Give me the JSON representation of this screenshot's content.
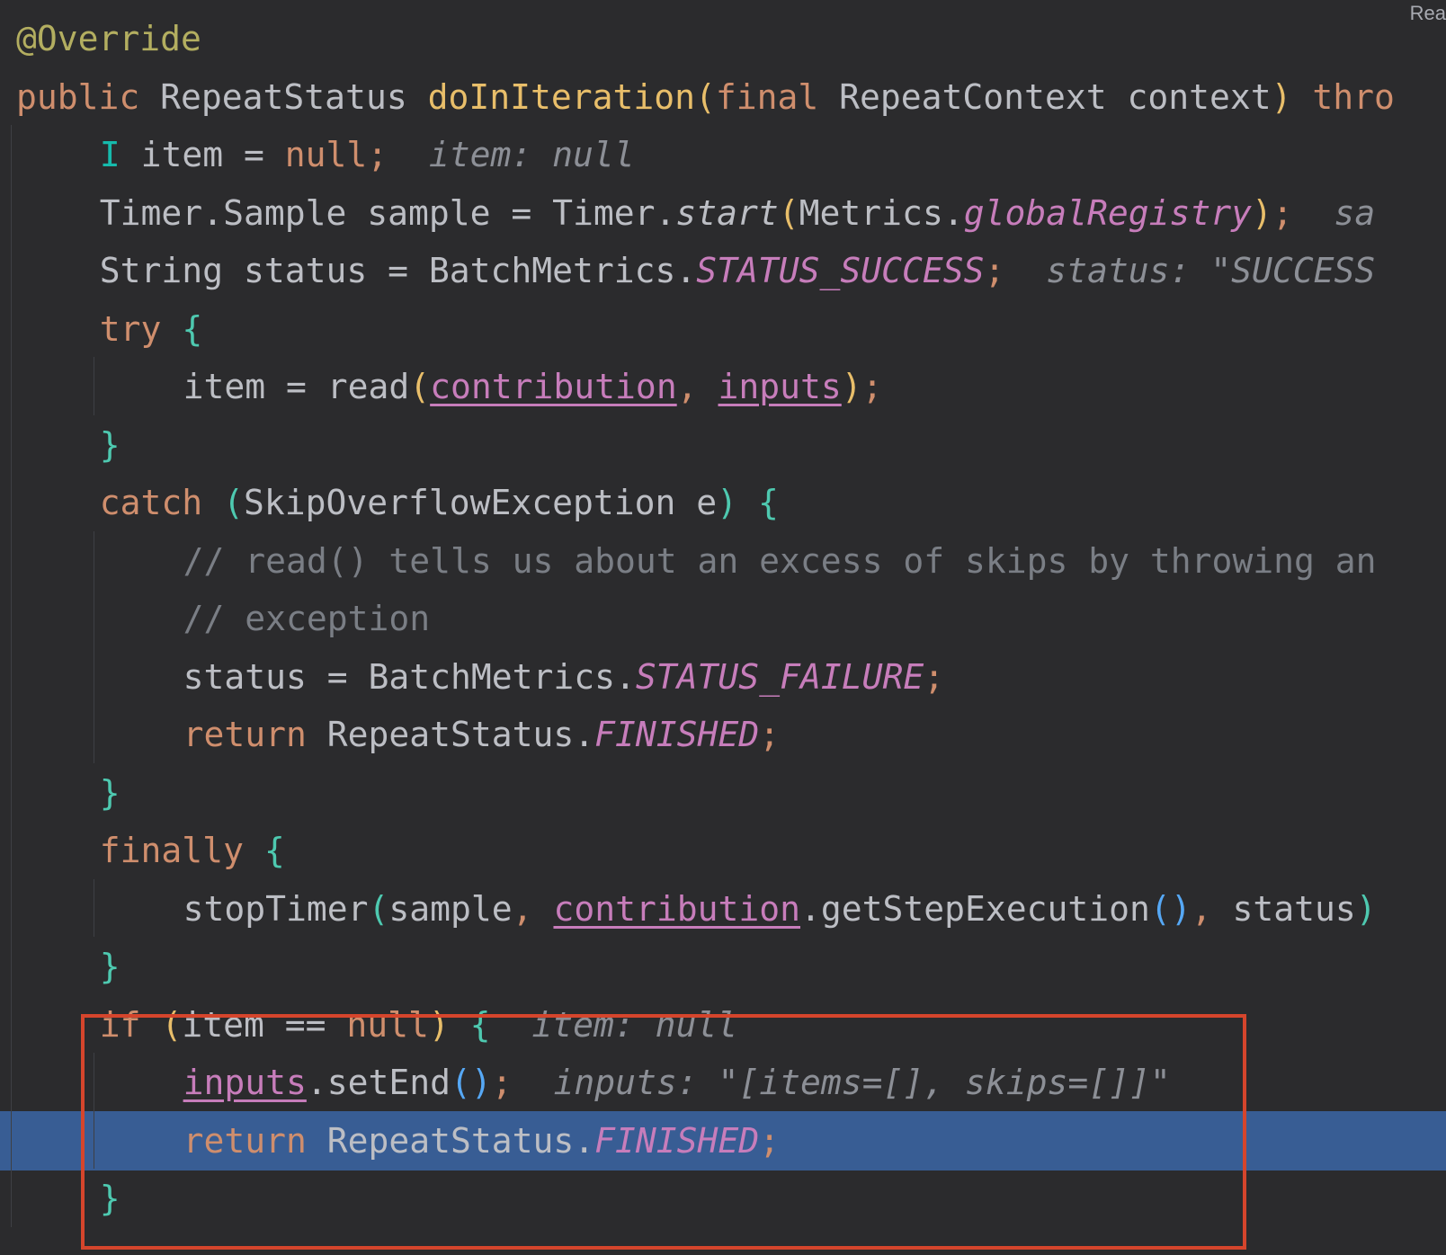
{
  "corner_label": "Rea",
  "colors": {
    "background": "#2b2b2d",
    "execution_line": "#385d94",
    "highlight_box": "#d5452c",
    "keyword": "#cf8e6d",
    "annotation": "#b3ae60",
    "field": "#c77dbb",
    "comment": "#7a7e85",
    "inline_hint": "#8c8f96"
  },
  "code_lines": [
    {
      "indent": 0,
      "tokens": [
        {
          "t": "@Override",
          "c": "ann"
        }
      ]
    },
    {
      "indent": 0,
      "tokens": [
        {
          "t": "public",
          "c": "kw"
        },
        {
          "t": " RepeatStatus "
        },
        {
          "t": "doInIteration",
          "c": "fn-def"
        },
        {
          "t": "(",
          "c": "br1"
        },
        {
          "t": "final",
          "c": "kw"
        },
        {
          "t": " RepeatContext context"
        },
        {
          "t": ")",
          "c": "br1"
        },
        {
          "t": " "
        },
        {
          "t": "thro",
          "c": "kw"
        }
      ]
    },
    {
      "indent": 4,
      "tokens": [
        {
          "t": "I",
          "c": "typeparam"
        },
        {
          "t": " item = "
        },
        {
          "t": "null",
          "c": "kw"
        },
        {
          "t": ";",
          "c": "kw"
        },
        {
          "t": "  "
        },
        {
          "t": "item: null",
          "c": "hint"
        }
      ]
    },
    {
      "indent": 4,
      "tokens": [
        {
          "t": "Timer.Sample sample = Timer."
        },
        {
          "t": "start",
          "c": "fn-it"
        },
        {
          "t": "(",
          "c": "br1"
        },
        {
          "t": "Metrics."
        },
        {
          "t": "globalRegistry",
          "c": "fld"
        },
        {
          "t": ")",
          "c": "br1"
        },
        {
          "t": ";",
          "c": "kw"
        },
        {
          "t": "  "
        },
        {
          "t": "sa",
          "c": "hint"
        }
      ]
    },
    {
      "indent": 4,
      "tokens": [
        {
          "t": "String status = BatchMetrics."
        },
        {
          "t": "STATUS_SUCCESS",
          "c": "fld"
        },
        {
          "t": ";",
          "c": "kw"
        },
        {
          "t": "  "
        },
        {
          "t": "status: \"SUCCESS",
          "c": "hint"
        }
      ]
    },
    {
      "indent": 4,
      "tokens": [
        {
          "t": "try",
          "c": "kw"
        },
        {
          "t": " "
        },
        {
          "t": "{",
          "c": "br2"
        }
      ]
    },
    {
      "indent": 8,
      "tokens": [
        {
          "t": "item = read"
        },
        {
          "t": "(",
          "c": "br1"
        },
        {
          "t": "contribution",
          "c": "ufld"
        },
        {
          "t": ",",
          "c": "kw"
        },
        {
          "t": " "
        },
        {
          "t": "inputs",
          "c": "ufld"
        },
        {
          "t": ")",
          "c": "br1"
        },
        {
          "t": ";",
          "c": "kw"
        }
      ]
    },
    {
      "indent": 4,
      "tokens": [
        {
          "t": "}",
          "c": "br2"
        }
      ]
    },
    {
      "indent": 4,
      "tokens": [
        {
          "t": "catch",
          "c": "kw"
        },
        {
          "t": " "
        },
        {
          "t": "(",
          "c": "br2"
        },
        {
          "t": "SkipOverflowException e"
        },
        {
          "t": ")",
          "c": "br2"
        },
        {
          "t": " "
        },
        {
          "t": "{",
          "c": "br2"
        }
      ]
    },
    {
      "indent": 8,
      "tokens": [
        {
          "t": "// read() tells us about an excess of skips by throwing an",
          "c": "cmt"
        }
      ]
    },
    {
      "indent": 8,
      "tokens": [
        {
          "t": "// exception",
          "c": "cmt"
        }
      ]
    },
    {
      "indent": 8,
      "tokens": [
        {
          "t": "status = BatchMetrics."
        },
        {
          "t": "STATUS_FAILURE",
          "c": "fld"
        },
        {
          "t": ";",
          "c": "kw"
        }
      ]
    },
    {
      "indent": 8,
      "tokens": [
        {
          "t": "return",
          "c": "kw"
        },
        {
          "t": " RepeatStatus."
        },
        {
          "t": "FINISHED",
          "c": "fld"
        },
        {
          "t": ";",
          "c": "kw"
        }
      ]
    },
    {
      "indent": 4,
      "tokens": [
        {
          "t": "}",
          "c": "br2"
        }
      ]
    },
    {
      "indent": 4,
      "tokens": [
        {
          "t": "finally",
          "c": "kw"
        },
        {
          "t": " "
        },
        {
          "t": "{",
          "c": "br2"
        }
      ]
    },
    {
      "indent": 8,
      "tokens": [
        {
          "t": "stopTimer"
        },
        {
          "t": "(",
          "c": "br2"
        },
        {
          "t": "sample"
        },
        {
          "t": ",",
          "c": "kw"
        },
        {
          "t": " "
        },
        {
          "t": "contribution",
          "c": "ufld"
        },
        {
          "t": ".getStepExecution"
        },
        {
          "t": "()",
          "c": "br3"
        },
        {
          "t": ",",
          "c": "kw"
        },
        {
          "t": " status"
        },
        {
          "t": ")",
          "c": "br2"
        }
      ]
    },
    {
      "indent": 4,
      "tokens": [
        {
          "t": "}",
          "c": "br2"
        }
      ]
    },
    {
      "indent": 4,
      "tokens": [
        {
          "t": "if",
          "c": "kw"
        },
        {
          "t": " "
        },
        {
          "t": "(",
          "c": "br1"
        },
        {
          "t": "item == "
        },
        {
          "t": "null",
          "c": "kw"
        },
        {
          "t": ")",
          "c": "br1"
        },
        {
          "t": " "
        },
        {
          "t": "{",
          "c": "br2"
        },
        {
          "t": "  "
        },
        {
          "t": "item: null",
          "c": "hint"
        }
      ]
    },
    {
      "indent": 8,
      "tokens": [
        {
          "t": "inputs",
          "c": "ufld"
        },
        {
          "t": ".setEnd"
        },
        {
          "t": "()",
          "c": "br3"
        },
        {
          "t": ";",
          "c": "kw"
        },
        {
          "t": "  "
        },
        {
          "t": "inputs: \"[items=[], skips=[]]\"",
          "c": "hint"
        }
      ]
    },
    {
      "indent": 8,
      "exec": true,
      "tokens": [
        {
          "t": "return",
          "c": "kw"
        },
        {
          "t": " RepeatStatus."
        },
        {
          "t": "FINISHED",
          "c": "fld"
        },
        {
          "t": ";",
          "c": "kw"
        }
      ]
    },
    {
      "indent": 4,
      "tokens": [
        {
          "t": "}",
          "c": "br2"
        }
      ]
    }
  ]
}
